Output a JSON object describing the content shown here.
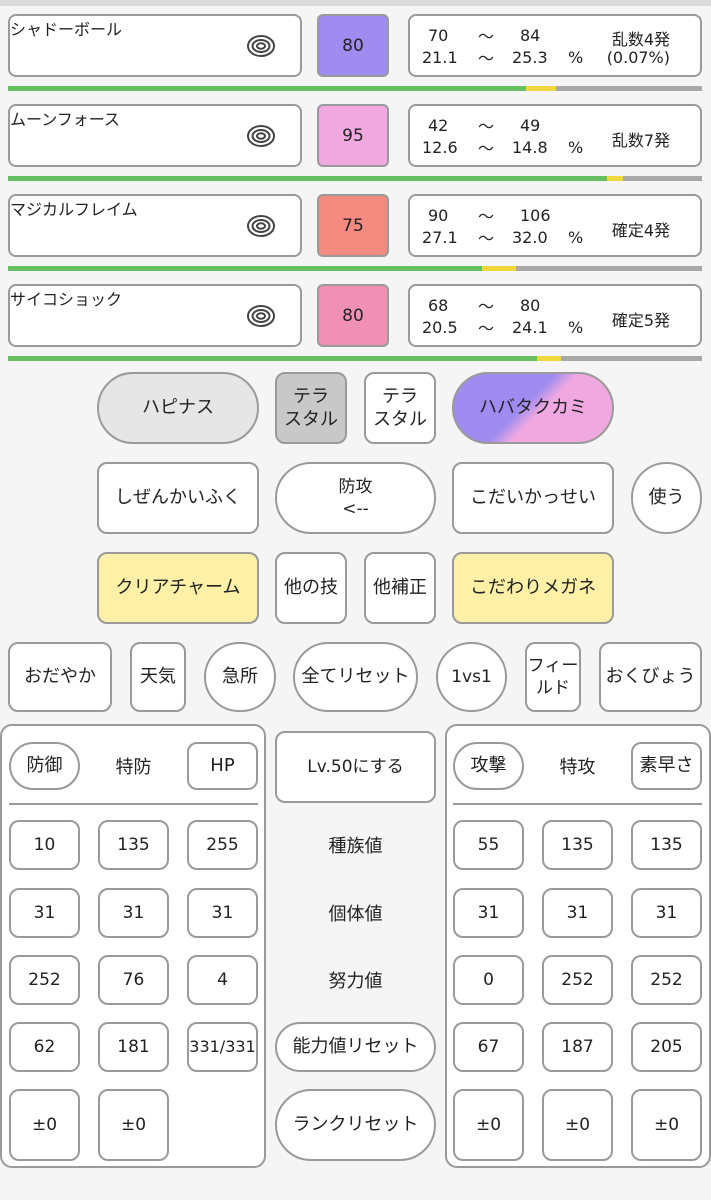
{
  "moves": [
    {
      "name": "シャドーボール",
      "power": "80",
      "color": "#a08cf0",
      "range_min": "70",
      "range_max": "84",
      "pct_min": "21.1",
      "pct_max": "25.3",
      "pct_unit": "%",
      "tilde": "〜",
      "result1": "乱数4発",
      "result2": "(0.07%)"
    },
    {
      "name": "ムーンフォース",
      "power": "95",
      "color": "#f0a8e0",
      "range_min": "42",
      "range_max": "49",
      "pct_min": "12.6",
      "pct_max": "14.8",
      "pct_unit": "%",
      "tilde": "〜",
      "result1": "乱数7発",
      "result2": ""
    },
    {
      "name": "マジカルフレイム",
      "power": "75",
      "color": "#f48a80",
      "range_min": "90",
      "range_max": "106",
      "pct_min": "27.1",
      "pct_max": "32.0",
      "pct_unit": "%",
      "tilde": "〜",
      "result1": "確定4発",
      "result2": ""
    },
    {
      "name": "サイコショック",
      "power": "80",
      "color": "#f090b4",
      "range_min": "68",
      "range_max": "80",
      "pct_min": "20.5",
      "pct_max": "24.1",
      "pct_unit": "%",
      "tilde": "〜",
      "result1": "確定5発",
      "result2": ""
    }
  ],
  "hp_bars": [
    {
      "green": 0.747,
      "yellow": 0.043
    },
    {
      "green": 0.863,
      "yellow": 0.023
    },
    {
      "green": 0.683,
      "yellow": 0.049
    },
    {
      "green": 0.762,
      "yellow": 0.035
    }
  ],
  "defender_name": "ハピナス",
  "tera_left": "テラ\nスタル",
  "tera_right": "テラ\nスタル",
  "attacker_name": "ハバタクカミ",
  "ability_left": "しぜんかいふく",
  "direction_label": "防攻\n<--",
  "ability_right": "こだいかっせい",
  "use_label": "使う",
  "item_left": "クリアチャーム",
  "other_move": "他の技",
  "other_mod": "他補正",
  "item_right": "こだわりメガネ",
  "row4": {
    "nature_left": "おだやか",
    "weather": "天気",
    "crit": "急所",
    "reset_all": "全てリセット",
    "mode": "1vs1",
    "field": "フィー\nルド",
    "nature_right": "おくびょう"
  },
  "left_header": {
    "def": "防御",
    "spdef": "特防",
    "hp": "HP"
  },
  "right_header": {
    "atk": "攻撃",
    "spatk": "特攻",
    "spe": "素早さ"
  },
  "center": {
    "lv50": "Lv.50にする",
    "base": "種族値",
    "iv": "個体値",
    "ev": "努力値",
    "stat_reset": "能力値リセット",
    "rank_reset": "ランクリセット"
  },
  "left_stats": {
    "base": [
      "10",
      "135",
      "255"
    ],
    "iv": [
      "31",
      "31",
      "31"
    ],
    "ev": [
      "252",
      "76",
      "4"
    ],
    "actual": [
      "62",
      "181",
      "331/331"
    ],
    "rank": [
      "±0",
      "±0"
    ]
  },
  "right_stats": {
    "base": [
      "55",
      "135",
      "135"
    ],
    "iv": [
      "31",
      "31",
      "31"
    ],
    "ev": [
      "0",
      "252",
      "252"
    ],
    "actual": [
      "67",
      "187",
      "205"
    ],
    "rank": [
      "±0",
      "±0",
      "±0"
    ]
  },
  "colors": {
    "tera_pressed": "#c8c8c8",
    "item_yellow": "#fff0a8",
    "attacker_a": "#a08cf0",
    "attacker_b": "#f0a8e0",
    "hp_green": "#66c060",
    "hp_yellow": "#f0d83c",
    "hp_gray": "#a8a8a8"
  },
  "icons": {
    "move_target": "concentric-ring-icon"
  }
}
